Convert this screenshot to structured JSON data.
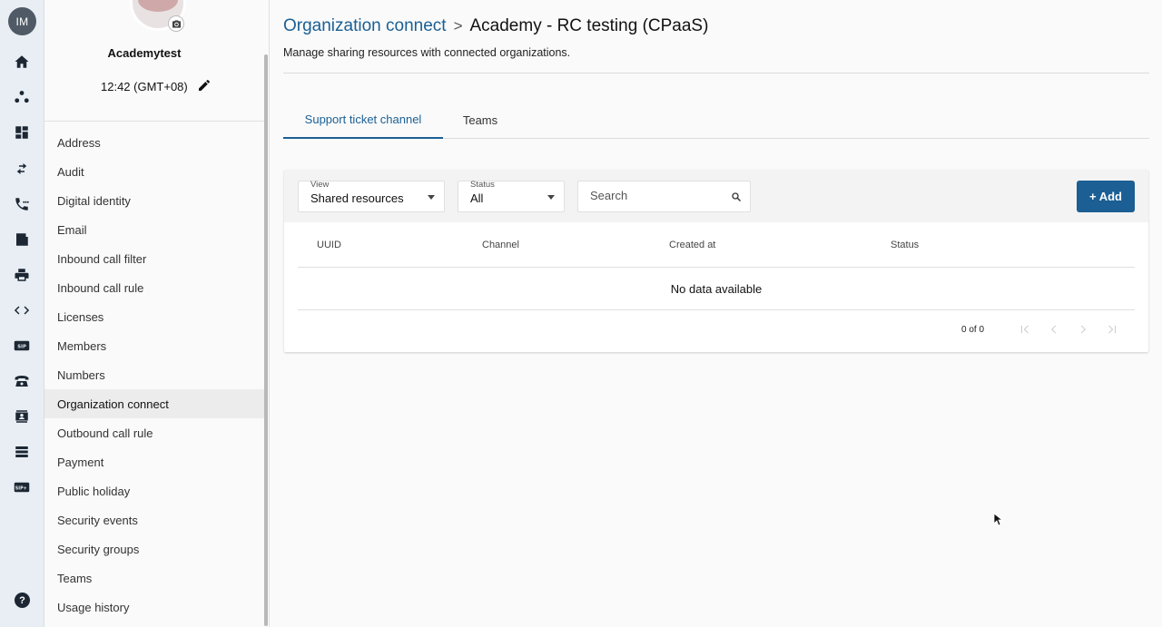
{
  "rail": {
    "user_initials": "IM",
    "icons": [
      "home-icon",
      "hierarchy-icon",
      "dashboard-icon",
      "transfer-arrows-icon",
      "phone-settings-icon",
      "report-icon",
      "printer-icon",
      "code-icon",
      "sip-icon",
      "desk-phone-icon",
      "contact-card-icon",
      "server-list-icon",
      "sip-plus-icon"
    ],
    "help_label": "?"
  },
  "side": {
    "org_name": "Academytest",
    "time": "12:42 (GMT+08)",
    "nav_items": [
      {
        "label": "Address"
      },
      {
        "label": "Audit"
      },
      {
        "label": "Digital identity"
      },
      {
        "label": "Email"
      },
      {
        "label": "Inbound call filter"
      },
      {
        "label": "Inbound call rule"
      },
      {
        "label": "Licenses"
      },
      {
        "label": "Members"
      },
      {
        "label": "Numbers"
      },
      {
        "label": "Organization connect"
      },
      {
        "label": "Outbound call rule"
      },
      {
        "label": "Payment"
      },
      {
        "label": "Public holiday"
      },
      {
        "label": "Security events"
      },
      {
        "label": "Security groups"
      },
      {
        "label": "Teams"
      },
      {
        "label": "Usage history"
      }
    ],
    "active_item": "Organization connect"
  },
  "main": {
    "breadcrumb_link": "Organization connect",
    "breadcrumb_sep": ">",
    "breadcrumb_current": "Academy - RC testing (CPaaS)",
    "subtitle": "Manage sharing resources with connected organizations.",
    "tabs": [
      {
        "label": "Support ticket channel",
        "active": true
      },
      {
        "label": "Teams",
        "active": false
      }
    ],
    "filters": {
      "view_label": "View",
      "view_value": "Shared resources",
      "status_label": "Status",
      "status_value": "All",
      "search_placeholder": "Search"
    },
    "add_button": "+ Add",
    "table": {
      "columns": [
        "UUID",
        "Channel",
        "Created at",
        "Status"
      ],
      "empty_text": "No data available"
    },
    "pager": {
      "count": "0 of 0"
    }
  },
  "colors": {
    "accent": "#1b5f94",
    "rail_bg": "#e8eef4",
    "active_nav_bg": "#ececec"
  }
}
